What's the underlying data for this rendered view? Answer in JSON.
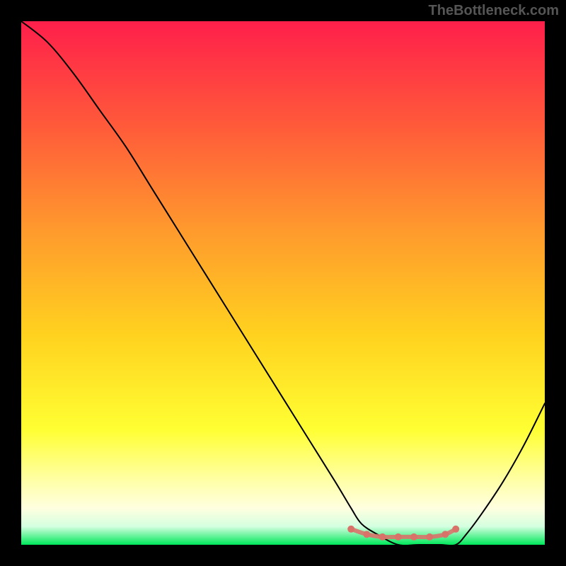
{
  "watermark": "TheBottleneck.com",
  "chart_data": {
    "type": "line",
    "title": "",
    "xlabel": "",
    "ylabel": "",
    "xlim": [
      0,
      100
    ],
    "ylim": [
      0,
      100
    ],
    "grid": false,
    "series": [
      {
        "name": "curve",
        "color": "#000000",
        "x": [
          0,
          5,
          10,
          15,
          20,
          25,
          30,
          35,
          40,
          45,
          50,
          55,
          60,
          63,
          65,
          68,
          72,
          76,
          80,
          83,
          85,
          88,
          92,
          96,
          100
        ],
        "y": [
          100,
          96,
          90,
          83,
          76,
          68,
          60,
          52,
          44,
          36,
          28,
          20,
          12,
          7,
          4,
          2,
          0,
          0,
          0,
          0,
          2,
          6,
          12,
          19,
          27
        ]
      },
      {
        "name": "marker-band",
        "color": "#d9736a",
        "x": [
          63,
          66,
          69,
          72,
          75,
          78,
          81,
          83
        ],
        "y": [
          3,
          2,
          1.5,
          1.5,
          1.5,
          1.5,
          2,
          3
        ]
      }
    ],
    "gradient_stops": [
      {
        "offset": 0.0,
        "color": "#ff1f4b"
      },
      {
        "offset": 0.2,
        "color": "#ff5a3a"
      },
      {
        "offset": 0.4,
        "color": "#ff9a2d"
      },
      {
        "offset": 0.6,
        "color": "#ffd21f"
      },
      {
        "offset": 0.78,
        "color": "#ffff33"
      },
      {
        "offset": 0.88,
        "color": "#ffffaa"
      },
      {
        "offset": 0.93,
        "color": "#ffffe0"
      },
      {
        "offset": 0.965,
        "color": "#d4ffe0"
      },
      {
        "offset": 1.0,
        "color": "#00e85b"
      }
    ]
  }
}
